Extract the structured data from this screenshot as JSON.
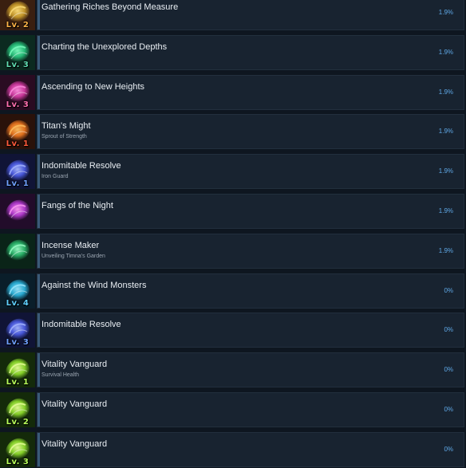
{
  "achievements": [
    {
      "title": "Gathering Riches Beyond Measure",
      "subtitle": "",
      "percent": "1.9%",
      "level": "Lv. 2",
      "icon": "golden-flame-icon",
      "colors": {
        "main": "#c89a2a",
        "glow": "#ffe07a",
        "bg": "#3a1f10",
        "level": "#ffb347"
      }
    },
    {
      "title": "Charting the Unexplored Depths",
      "subtitle": "",
      "percent": "1.9%",
      "level": "Lv. 3",
      "icon": "green-swirl-icon",
      "colors": {
        "main": "#27c07a",
        "glow": "#7dffc0",
        "bg": "#0c2a20",
        "level": "#5fdcb0"
      }
    },
    {
      "title": "Ascending to New Heights",
      "subtitle": "",
      "percent": "1.9%",
      "level": "Lv. 3",
      "icon": "magenta-wing-icon",
      "colors": {
        "main": "#d03aa0",
        "glow": "#ff8ee0",
        "bg": "#2a0c22",
        "level": "#ff6fb0"
      }
    },
    {
      "title": "Titan's Might",
      "subtitle": "Sprout of Strength",
      "percent": "1.9%",
      "level": "Lv. 1",
      "icon": "orange-blaze-icon",
      "colors": {
        "main": "#e8741e",
        "glow": "#ffc060",
        "bg": "#2a120a",
        "level": "#ff5a3a"
      }
    },
    {
      "title": "Indomitable Resolve",
      "subtitle": "Iron Guard",
      "percent": "1.9%",
      "level": "Lv. 1",
      "icon": "blue-wave-icon",
      "colors": {
        "main": "#4a5ae0",
        "glow": "#a8b8ff",
        "bg": "#101436",
        "level": "#6fa0ff"
      }
    },
    {
      "title": "Fangs of the Night",
      "subtitle": "",
      "percent": "1.9%",
      "level": "",
      "icon": "purple-fang-icon",
      "colors": {
        "main": "#b43ad0",
        "glow": "#ff9cf4",
        "bg": "#220c2a",
        "level": "#e070ff"
      }
    },
    {
      "title": "Incense Maker",
      "subtitle": "Unveiling Timna's Garden",
      "percent": "1.9%",
      "level": "",
      "icon": "green-leaf-icon",
      "colors": {
        "main": "#2ab46a",
        "glow": "#9cffc8",
        "bg": "#0a2418",
        "level": "#6fe0a8"
      }
    },
    {
      "title": "Against the Wind Monsters",
      "subtitle": "",
      "percent": "0%",
      "level": "Lv. 4",
      "icon": "cyan-tornado-icon",
      "colors": {
        "main": "#2ab0d8",
        "glow": "#9ce8ff",
        "bg": "#0a1e2a",
        "level": "#5fd0ff"
      }
    },
    {
      "title": "Indomitable Resolve",
      "subtitle": "",
      "percent": "0%",
      "level": "Lv. 3",
      "icon": "blue-wave-icon",
      "colors": {
        "main": "#4a5ae0",
        "glow": "#a8b8ff",
        "bg": "#101436",
        "level": "#6fa0ff"
      }
    },
    {
      "title": "Vitality Vanguard",
      "subtitle": "Survival Health",
      "percent": "0%",
      "level": "Lv. 1",
      "icon": "lime-shield-icon",
      "colors": {
        "main": "#8ad82a",
        "glow": "#eaff9c",
        "bg": "#142a0a",
        "level": "#b8ff5a"
      }
    },
    {
      "title": "Vitality Vanguard",
      "subtitle": "",
      "percent": "0%",
      "level": "Lv. 2",
      "icon": "lime-shield-icon",
      "colors": {
        "main": "#8ad82a",
        "glow": "#eaff9c",
        "bg": "#142a0a",
        "level": "#b8ff5a"
      }
    },
    {
      "title": "Vitality Vanguard",
      "subtitle": "",
      "percent": "0%",
      "level": "Lv. 3",
      "icon": "lime-shield-icon",
      "colors": {
        "main": "#8ad82a",
        "glow": "#eaff9c",
        "bg": "#142a0a",
        "level": "#b8ff5a"
      }
    }
  ]
}
